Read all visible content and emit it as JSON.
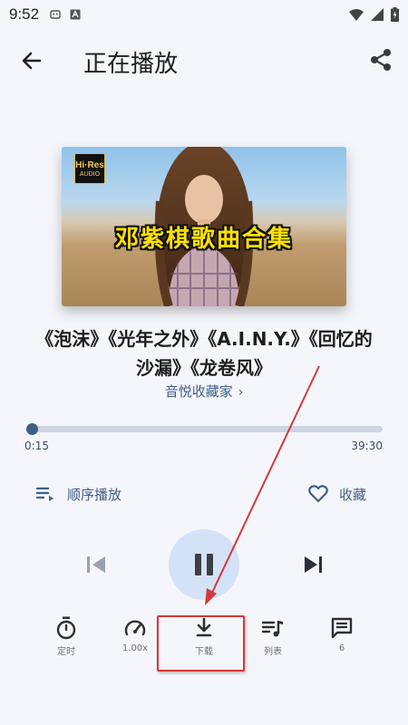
{
  "status_bar": {
    "time": "9:52",
    "left_icons": [
      "notification-icon",
      "app-icon"
    ],
    "right_icons": [
      "wifi-icon",
      "signal-icon",
      "battery-icon"
    ]
  },
  "header": {
    "title": "正在播放",
    "back_icon": "arrow-left-icon",
    "share_icon": "share-icon"
  },
  "cover": {
    "badge_top": "Hi·Res",
    "badge_bottom": "AUDIO",
    "banner_text": "邓紫棋歌曲合集"
  },
  "track": {
    "title": "《泡沫》《光年之外》《A.I.N.Y.》《回忆的沙漏》《龙卷风》",
    "artist": "音悦收藏家",
    "artist_chevron": "›"
  },
  "progress": {
    "elapsed": "0:15",
    "total": "39:30",
    "fraction": 0.006
  },
  "controls": {
    "mode_label": "顺序播放",
    "favorite_label": "收藏",
    "state": "playing"
  },
  "toolbar": {
    "timer_label": "定时",
    "speed_label": "1.00x",
    "download_label": "下载",
    "playlist_label": "列表",
    "comments_label": "6"
  },
  "colors": {
    "accent": "#3e5e89",
    "play_button_bg": "#d4e2f8",
    "annotation": "#d43838",
    "banner_text": "#ffe100"
  }
}
